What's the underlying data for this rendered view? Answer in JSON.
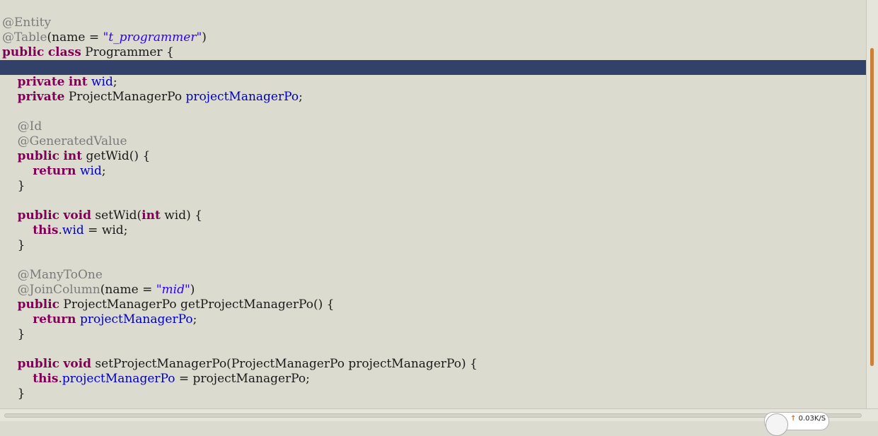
{
  "editor": {
    "language": "java",
    "current_line_index": 3,
    "lines": [
      [
        {
          "t": "@Entity",
          "c": "ann"
        }
      ],
      [
        {
          "t": "@Table",
          "c": "ann"
        },
        {
          "t": "(name = ",
          "c": "pun"
        },
        {
          "t": "\"t_programmer\"",
          "c": "str"
        },
        {
          "t": ")",
          "c": "pun"
        }
      ],
      [
        {
          "t": "public",
          "c": "kw"
        },
        {
          "t": " ",
          "c": "pun"
        },
        {
          "t": "class",
          "c": "kw"
        },
        {
          "t": " Programmer {",
          "c": "pun"
        }
      ],
      [],
      [
        {
          "t": "    ",
          "c": "pun"
        },
        {
          "t": "private",
          "c": "kw"
        },
        {
          "t": " ",
          "c": "pun"
        },
        {
          "t": "int",
          "c": "kw"
        },
        {
          "t": " ",
          "c": "pun"
        },
        {
          "t": "wid",
          "c": "fld"
        },
        {
          "t": ";",
          "c": "pun"
        }
      ],
      [
        {
          "t": "    ",
          "c": "pun"
        },
        {
          "t": "private",
          "c": "kw"
        },
        {
          "t": " ProjectManagerPo ",
          "c": "pun"
        },
        {
          "t": "projectManagerPo",
          "c": "fld"
        },
        {
          "t": ";",
          "c": "pun"
        }
      ],
      [],
      [
        {
          "t": "    ",
          "c": "pun"
        },
        {
          "t": "@Id",
          "c": "ann"
        }
      ],
      [
        {
          "t": "    ",
          "c": "pun"
        },
        {
          "t": "@GeneratedValue",
          "c": "ann"
        }
      ],
      [
        {
          "t": "    ",
          "c": "pun"
        },
        {
          "t": "public",
          "c": "kw"
        },
        {
          "t": " ",
          "c": "pun"
        },
        {
          "t": "int",
          "c": "kw"
        },
        {
          "t": " getWid() {",
          "c": "pun"
        }
      ],
      [
        {
          "t": "        ",
          "c": "pun"
        },
        {
          "t": "return",
          "c": "kw"
        },
        {
          "t": " ",
          "c": "pun"
        },
        {
          "t": "wid",
          "c": "fld"
        },
        {
          "t": ";",
          "c": "pun"
        }
      ],
      [
        {
          "t": "    }",
          "c": "pun"
        }
      ],
      [],
      [
        {
          "t": "    ",
          "c": "pun"
        },
        {
          "t": "public",
          "c": "kw"
        },
        {
          "t": " ",
          "c": "pun"
        },
        {
          "t": "void",
          "c": "kw"
        },
        {
          "t": " setWid(",
          "c": "pun"
        },
        {
          "t": "int",
          "c": "kw"
        },
        {
          "t": " wid) {",
          "c": "pun"
        }
      ],
      [
        {
          "t": "        ",
          "c": "pun"
        },
        {
          "t": "this",
          "c": "kw"
        },
        {
          "t": ".",
          "c": "pun"
        },
        {
          "t": "wid",
          "c": "fld"
        },
        {
          "t": " = wid;",
          "c": "pun"
        }
      ],
      [
        {
          "t": "    }",
          "c": "pun"
        }
      ],
      [],
      [
        {
          "t": "    ",
          "c": "pun"
        },
        {
          "t": "@ManyToOne",
          "c": "ann"
        }
      ],
      [
        {
          "t": "    ",
          "c": "pun"
        },
        {
          "t": "@JoinColumn",
          "c": "ann"
        },
        {
          "t": "(name = ",
          "c": "pun"
        },
        {
          "t": "\"mid\"",
          "c": "str"
        },
        {
          "t": ")",
          "c": "pun"
        }
      ],
      [
        {
          "t": "    ",
          "c": "pun"
        },
        {
          "t": "public",
          "c": "kw"
        },
        {
          "t": " ProjectManagerPo getProjectManagerPo() {",
          "c": "pun"
        }
      ],
      [
        {
          "t": "        ",
          "c": "pun"
        },
        {
          "t": "return",
          "c": "kw"
        },
        {
          "t": " ",
          "c": "pun"
        },
        {
          "t": "projectManagerPo",
          "c": "fld"
        },
        {
          "t": ";",
          "c": "pun"
        }
      ],
      [
        {
          "t": "    }",
          "c": "pun"
        }
      ],
      [],
      [
        {
          "t": "    ",
          "c": "pun"
        },
        {
          "t": "public",
          "c": "kw"
        },
        {
          "t": " ",
          "c": "pun"
        },
        {
          "t": "void",
          "c": "kw"
        },
        {
          "t": " setProjectManagerPo(ProjectManagerPo projectManagerPo) {",
          "c": "pun"
        }
      ],
      [
        {
          "t": "        ",
          "c": "pun"
        },
        {
          "t": "this",
          "c": "kw"
        },
        {
          "t": ".",
          "c": "pun"
        },
        {
          "t": "projectManagerPo",
          "c": "fld"
        },
        {
          "t": " = projectManagerPo;",
          "c": "pun"
        }
      ],
      [
        {
          "t": "    }",
          "c": "pun"
        }
      ]
    ]
  },
  "colors": {
    "background": "#dcdbd0",
    "current_line": "#32416a",
    "keyword": "#7f0055",
    "annotation": "#7a7a7a",
    "field": "#0000c0",
    "string": "#2a00ff",
    "scrollbar_thumb": "#c8803a"
  },
  "net_widget": {
    "arrow_icon": "arrow-up-icon",
    "arrow": "↑",
    "speed": "0.03K/S"
  }
}
